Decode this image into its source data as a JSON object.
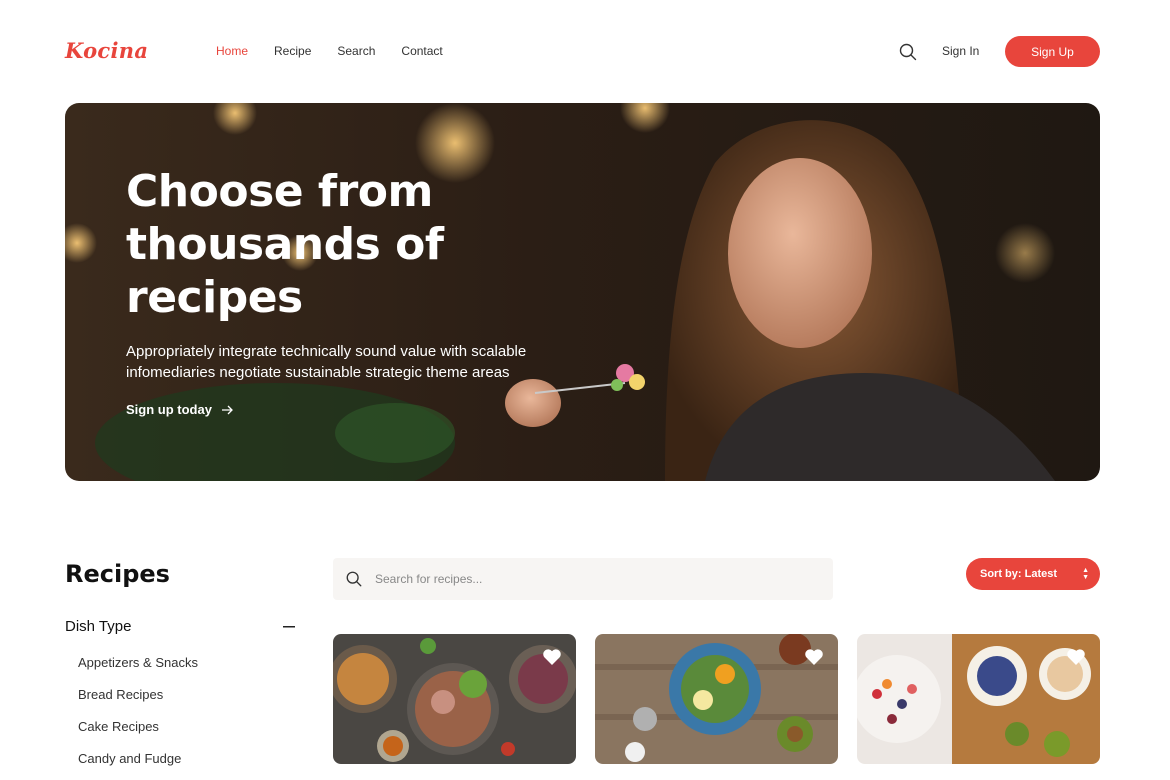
{
  "header": {
    "logo": "Kocina",
    "nav": [
      {
        "label": "Home",
        "active": true
      },
      {
        "label": "Recipe",
        "active": false
      },
      {
        "label": "Search",
        "active": false
      },
      {
        "label": "Contact",
        "active": false
      }
    ],
    "search_icon": "search-icon",
    "signin_label": "Sign In",
    "signup_label": "Sign Up"
  },
  "hero": {
    "title": "Choose from thousands of recipes",
    "subtitle": "Appropriately integrate technically sound value with scalable infomediaries negotiate sustainable strategic theme areas",
    "cta_label": "Sign up today",
    "cta_icon": "arrow-right-icon"
  },
  "sidebar": {
    "title": "Recipes",
    "filter_title": "Dish Type",
    "filter_toggle_icon": "minus-icon",
    "items": [
      "Appetizers & Snacks",
      "Bread Recipes",
      "Cake Recipes",
      "Candy and Fudge"
    ]
  },
  "search": {
    "placeholder": "Search for recipes...",
    "value": ""
  },
  "sort": {
    "label": "Sort by: Latest"
  },
  "cards": [
    {
      "favorite_icon": "heart-icon"
    },
    {
      "favorite_icon": "heart-icon"
    },
    {
      "favorite_icon": "heart-icon"
    }
  ],
  "colors": {
    "accent": "#e8453c",
    "text": "#222222",
    "search_bg": "#f7f5f3"
  }
}
